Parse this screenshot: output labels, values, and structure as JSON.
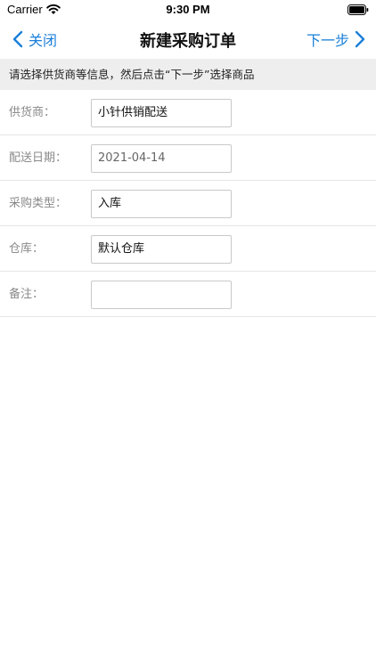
{
  "status_bar": {
    "carrier": "Carrier",
    "time": "9:30 PM"
  },
  "nav": {
    "back_label": "关闭",
    "title": "新建采购订单",
    "next_label": "下一步"
  },
  "hint": {
    "text": "请选择供货商等信息，然后点击“下一步”选择商品"
  },
  "form": {
    "fields": [
      {
        "label": "供货商：",
        "value": "小针供销配送"
      },
      {
        "label": "配送日期：",
        "value": "2021-04-14"
      },
      {
        "label": "采购类型：",
        "value": "入库"
      },
      {
        "label": "仓库：",
        "value": "默认仓库"
      },
      {
        "label": "备注：",
        "value": ""
      }
    ]
  },
  "colors": {
    "accent": "#1a7fd9",
    "banner_bg": "#eeeeee",
    "label": "#8a8a8a"
  },
  "icons": [
    "wifi-icon",
    "battery-icon",
    "chevron-left-icon",
    "chevron-right-icon"
  ]
}
